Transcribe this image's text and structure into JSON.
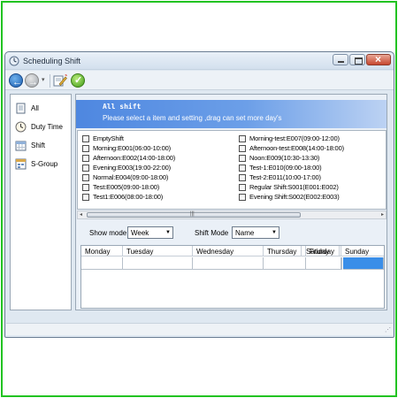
{
  "window": {
    "title": "Scheduling Shift"
  },
  "toolbar": {
    "dropdown_glyph": "▾"
  },
  "sidebar": {
    "items": [
      {
        "label": "All",
        "icon": "document-icon"
      },
      {
        "label": "Duty Time",
        "icon": "clock-icon"
      },
      {
        "label": "Shift",
        "icon": "calendar-icon"
      },
      {
        "label": "S-Group",
        "icon": "group-calendar-icon"
      }
    ]
  },
  "banner": {
    "title": "All shift",
    "hint": "Please select a item and setting ,drag can set more day's"
  },
  "shifts": {
    "left": [
      "EmptyShift",
      "Morning:E001(06:00-10:00)",
      "Afternoon:E002(14:00-18:00)",
      "Evening:E003(19:00-22:00)",
      "Normal:E004(09:00-18:00)",
      "Test:E005(09:00-18:00)",
      "Test1:E006(08:00-18:00)"
    ],
    "right": [
      "Morning-test:E007(09:00-12:00)",
      "Afternoon-test:E008(14:00-18:00)",
      "Noon:E009(10:30-13:30)",
      "Test-1:E010(09:00-18:00)",
      "Test-2:E011(10:00-17:00)",
      "Regular Shift:S001(E001:E002)",
      "Evening Shift:S002(E002:E003)"
    ]
  },
  "filters": {
    "show_mode_label": "Show mode:",
    "show_mode_value": "Week",
    "shift_mode_label": "Shift Mode",
    "shift_mode_value": "Name"
  },
  "week": {
    "days": [
      "Monday",
      "Tuesday",
      "Wednesday",
      "Thursday",
      "Friday",
      "Saturday",
      "Sunday"
    ],
    "selected_day": "Sunday"
  },
  "colors": {
    "banner": "#4e87e0",
    "selected_cell": "#3a8ee8",
    "frame": "#21c321"
  }
}
